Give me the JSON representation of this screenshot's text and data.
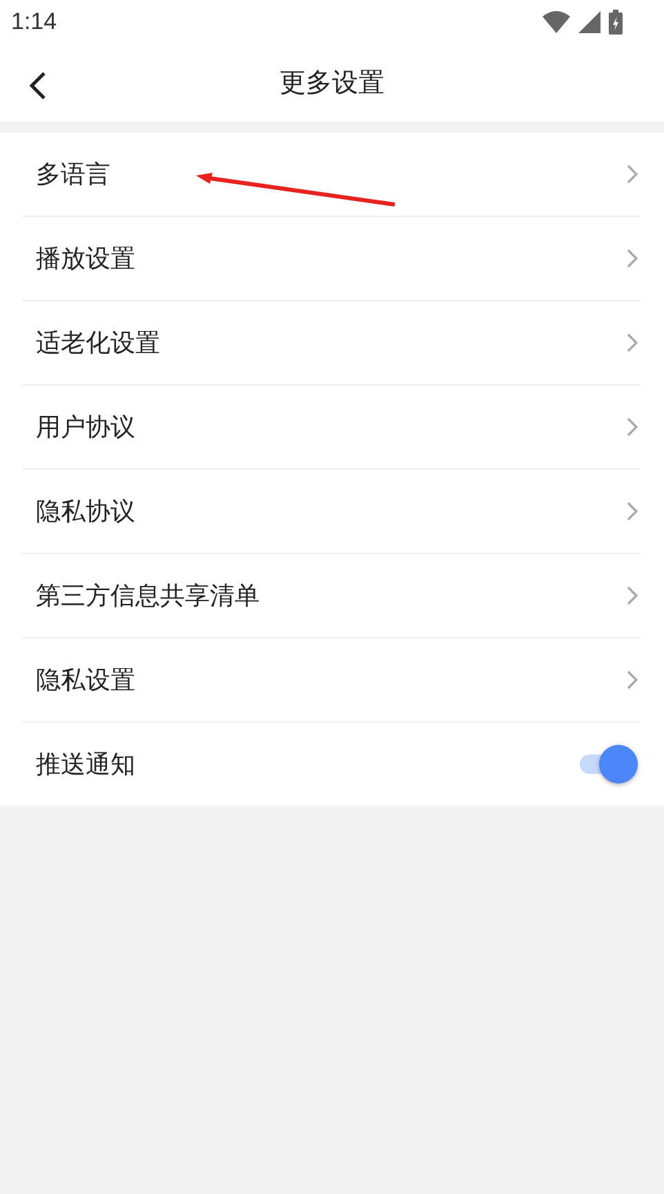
{
  "status_bar": {
    "time": "1:14"
  },
  "header": {
    "title": "更多设置"
  },
  "items": [
    {
      "kind": "link",
      "label": "多语言"
    },
    {
      "kind": "link",
      "label": "播放设置"
    },
    {
      "kind": "link",
      "label": "适老化设置"
    },
    {
      "kind": "link",
      "label": "用户协议"
    },
    {
      "kind": "link",
      "label": "隐私协议"
    },
    {
      "kind": "link",
      "label": "第三方信息共享清单"
    },
    {
      "kind": "link",
      "label": "隐私设置"
    },
    {
      "kind": "toggle",
      "label": "推送通知",
      "on": true
    }
  ]
}
